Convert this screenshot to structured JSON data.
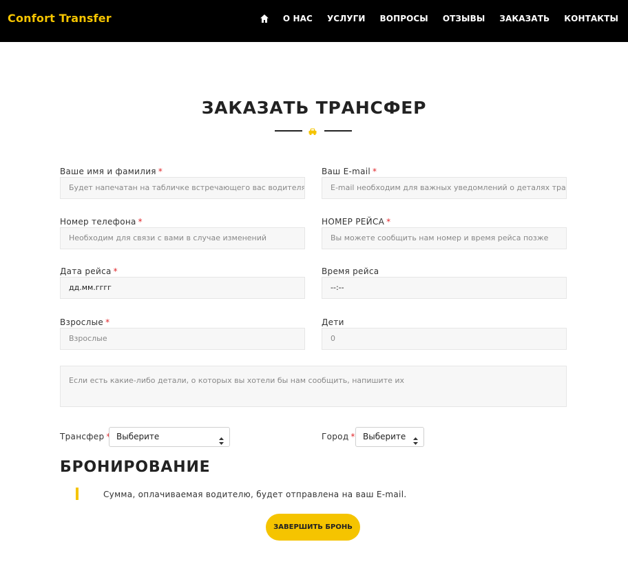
{
  "header": {
    "brand": "Confort Transfer",
    "nav": {
      "home_icon": "home-icon",
      "items": [
        "О НАС",
        "УСЛУГИ",
        "ВОПРОСЫ",
        "ОТЗЫВЫ",
        "ЗАКАЗАТЬ",
        "КОНТАКТЫ"
      ]
    }
  },
  "section": {
    "title": "ЗАКАЗАТЬ ТРАНСФЕР",
    "divider_icon": "car-icon",
    "accent_color": "#f5c400"
  },
  "form": {
    "name": {
      "label": "Ваше имя и фамилия",
      "required": "*",
      "placeholder": "Будет напечатан на табличке встречающего вас водителя"
    },
    "email": {
      "label": "Ваш E-mail",
      "required": "*",
      "placeholder": "E-mail необходим для важных уведомлений о деталях трансфера"
    },
    "phone": {
      "label": "Номер телефона",
      "required": "*",
      "placeholder": "Необходим для связи с вами в случае изменений"
    },
    "flight": {
      "label": "НОМЕР РЕЙСА",
      "required": "*",
      "placeholder": "Вы можете сообщить нам номер и время рейса позже"
    },
    "date": {
      "label": "Дата рейса",
      "required": "*",
      "value": "дд.мм.гггг"
    },
    "time": {
      "label": "Время рейса",
      "value": "--:--"
    },
    "adults": {
      "label": "Взрослые",
      "required": "*",
      "placeholder": "Взрослые"
    },
    "children": {
      "label": "Дети",
      "value": "0"
    },
    "details": {
      "placeholder": "Если есть какие-либо детали, о которых вы хотели бы нам сообщить, напишите их"
    },
    "transfer": {
      "label": "Трансфер",
      "required": "*",
      "selected": "Выберите"
    },
    "city": {
      "label": "Город",
      "required": "*",
      "selected": "Выберите"
    }
  },
  "booking": {
    "title": "БРОНИРОВАНИЕ",
    "note": "Сумма, оплачиваемая водителю, будет отправлена на ваш E-mail.",
    "submit": "ЗАВЕРШИТЬ БРОНЬ"
  }
}
